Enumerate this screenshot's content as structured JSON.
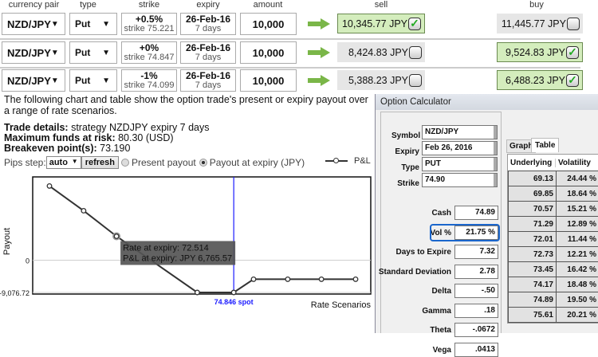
{
  "headers": {
    "pair": "currency pair",
    "type": "type",
    "strike": "strike",
    "expiry": "expiry",
    "amount": "amount",
    "sell": "sell",
    "buy": "buy"
  },
  "rows": [
    {
      "pair": "NZD/JPY",
      "type": "Put",
      "pct": "+0.5%",
      "strike": "strike 75.221",
      "expiry": "26-Feb-16",
      "days": "7 days",
      "amount": "10,000",
      "sell": "10,345.77 JPY",
      "sell_checked": true,
      "buy": "11,445.77 JPY",
      "buy_checked": false
    },
    {
      "pair": "NZD/JPY",
      "type": "Put",
      "pct": "+0%",
      "strike": "strike 74.847",
      "expiry": "26-Feb-16",
      "days": "7 days",
      "amount": "10,000",
      "sell": "8,424.83 JPY",
      "sell_checked": false,
      "buy": "9,524.83 JPY",
      "buy_checked": true
    },
    {
      "pair": "NZD/JPY",
      "type": "Put",
      "pct": "-1%",
      "strike": "strike 74.099",
      "expiry": "26-Feb-16",
      "days": "7 days",
      "amount": "10,000",
      "sell": "5,388.23 JPY",
      "sell_checked": false,
      "buy": "6,488.23 JPY",
      "buy_checked": true
    }
  ],
  "intro": "The following chart and table show the option trade's present or expiry payout over a range of rate scenarios.",
  "details": {
    "trade_label": "Trade details:",
    "trade": " strategy NZDJPY expiry 7 days",
    "risk_label": "Maximum funds at risk:",
    "risk": " 80.30 (USD)",
    "be_label": "Breakeven point(s):",
    "be": " 73.190"
  },
  "controls": {
    "pips_label": "Pips step:",
    "pips_value": "auto",
    "refresh": "refresh",
    "present": "Present payout",
    "expiry": "Payout at expiry (JPY)",
    "legend": "P&L"
  },
  "chart_data": {
    "type": "line",
    "ylabel": "Payout",
    "xlabel": "Rate Scenarios",
    "y_ticks": [
      "0",
      "-9,076.72"
    ],
    "spot_label": "74.846 spot",
    "spot": 74.846,
    "x": [
      71.18,
      71.86,
      72.514,
      74.12,
      74.846,
      75.24,
      75.92,
      76.59,
      77.27
    ],
    "y": [
      20940,
      13960,
      6765.57,
      -9076.72,
      -9076.72,
      -5350,
      -5350,
      -5350,
      -5350
    ],
    "ylim": [
      -10200,
      22600
    ],
    "tooltip": {
      "line1": "Rate at expiry: 72.514",
      "line2": "P&L at expiry: JPY 6,765.57"
    }
  },
  "calc": {
    "title": "Option Calculator",
    "symbol_label": "Symbol",
    "symbol": "NZD/JPY",
    "expiry_label": "Expiry",
    "expiry": "Feb 26, 2016",
    "type_label": "Type",
    "type": "PUT",
    "strike_label": "Strike",
    "strike": "74.90",
    "fields": [
      {
        "label": "Cash",
        "value": "74.89"
      },
      {
        "label": "Vol %",
        "value": "21.75 %"
      },
      {
        "label": "Days to Expire",
        "value": "7.32"
      },
      {
        "label": "Standard Deviation",
        "value": "2.78"
      },
      {
        "label": "Delta",
        "value": "-.50"
      },
      {
        "label": "Gamma",
        "value": ".18"
      },
      {
        "label": "Theta",
        "value": "-.0672"
      },
      {
        "label": "Vega",
        "value": ".0413"
      }
    ],
    "tabs": [
      "Graph",
      "Table"
    ],
    "col1": "Underlying",
    "col2": "Volatility",
    "table": [
      [
        "69.13",
        "24.44 %"
      ],
      [
        "69.85",
        "18.64 %"
      ],
      [
        "70.57",
        "15.21 %"
      ],
      [
        "71.29",
        "12.89 %"
      ],
      [
        "72.01",
        "11.44 %"
      ],
      [
        "72.73",
        "12.21 %"
      ],
      [
        "73.45",
        "16.42 %"
      ],
      [
        "74.17",
        "18.48 %"
      ],
      [
        "74.89",
        "19.50 %"
      ],
      [
        "75.61",
        "20.21 %"
      ]
    ]
  }
}
